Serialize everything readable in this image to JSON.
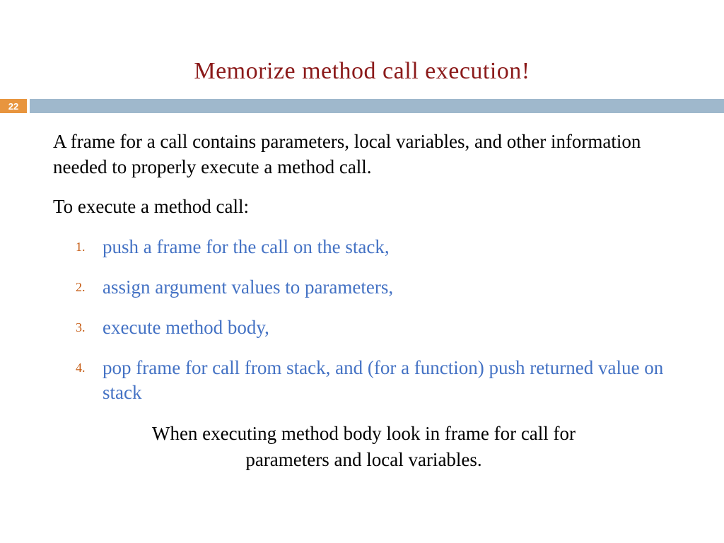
{
  "title": "Memorize method call execution!",
  "page_number": "22",
  "intro": "A frame for a call contains parameters, local variables, and other information needed to properly execute a method call.",
  "subhead": "To execute a method call:",
  "steps": [
    "push a frame for the call on the stack,",
    "assign argument values to parameters,",
    "execute method body,",
    "pop frame for call from stack, and (for a function) push returned value on stack"
  ],
  "footer": "When executing method body look in frame for call for parameters and local variables."
}
